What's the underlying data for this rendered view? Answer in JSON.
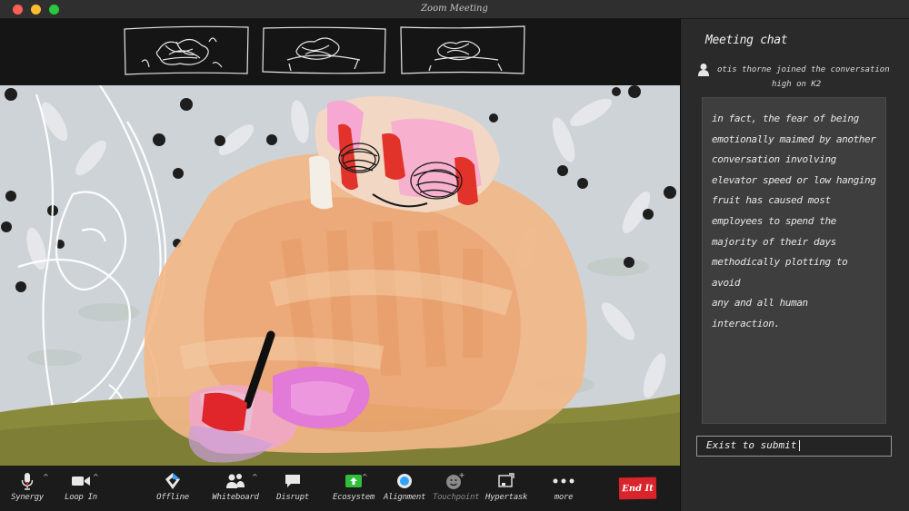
{
  "window": {
    "title": "Zoom Meeting"
  },
  "chat": {
    "title": "Meeting chat",
    "join_notice": {
      "line1": "otis thorne  joined the conversation",
      "line2": "high on K2"
    },
    "message_lines": [
      "in fact, the fear of being",
      "emotionally maimed by another",
      "conversation involving",
      "elevator speed or low hanging",
      "fruit has caused most",
      "employees to spend the",
      "majority of their days",
      "methodically plotting to avoid",
      "any and all human interaction."
    ],
    "input_value": "Exist to submit",
    "input_icons": {
      "user": "user-icon"
    }
  },
  "toolbar": {
    "synergy": "Synergy",
    "loop_in": "Loop In",
    "offline": "Offline",
    "whiteboard": "Whiteboard",
    "disrupt": "Disrupt",
    "ecosystem": "Ecosystem",
    "alignment": "Alignment",
    "touchpoint": "Touchpoint",
    "hypertask": "Hypertask",
    "more": "more",
    "end": "End It"
  },
  "colors": {
    "end_button": "#d9242b",
    "ecosystem_green": "#2fbf3a",
    "alignment_blue": "#2fa4ff"
  }
}
